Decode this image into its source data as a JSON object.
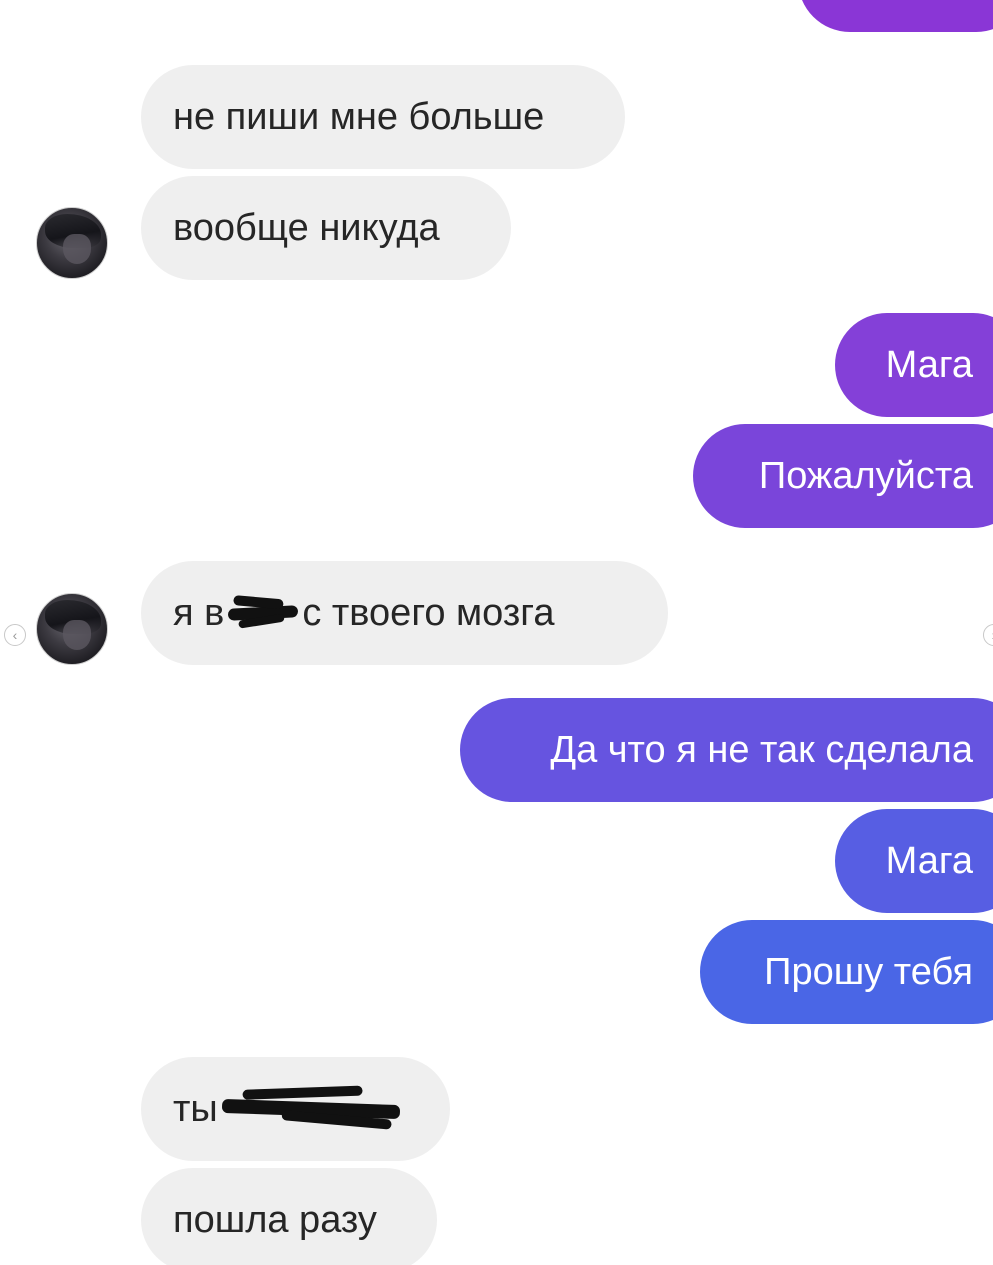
{
  "messages": [
    {
      "sender": "other",
      "text": "не пиши мне больше"
    },
    {
      "sender": "other",
      "text": "вообще никуда"
    },
    {
      "sender": "me",
      "text": "Мага"
    },
    {
      "sender": "me",
      "text": "Пожалуйста"
    },
    {
      "sender": "other",
      "text_before": "я в",
      "text_after": "с твоего мозга",
      "redacted": true
    },
    {
      "sender": "me",
      "text": "Да что я не так сделала"
    },
    {
      "sender": "me",
      "text": "Мага"
    },
    {
      "sender": "me",
      "text": "Прошу тебя"
    },
    {
      "sender": "other",
      "text_before": "ты",
      "redacted": true
    },
    {
      "sender": "other",
      "text": "пошла разу"
    }
  ],
  "colors": {
    "incoming_bg": "#efefef",
    "incoming_text": "#262626",
    "outgoing_top": "#8a36d6",
    "outgoing_mid": "#6a4fe0",
    "outgoing_bottom": "#4a66e6"
  },
  "icons": {
    "left_nav": "chevron-left-icon",
    "right_nav": "chevron-right-icon"
  }
}
